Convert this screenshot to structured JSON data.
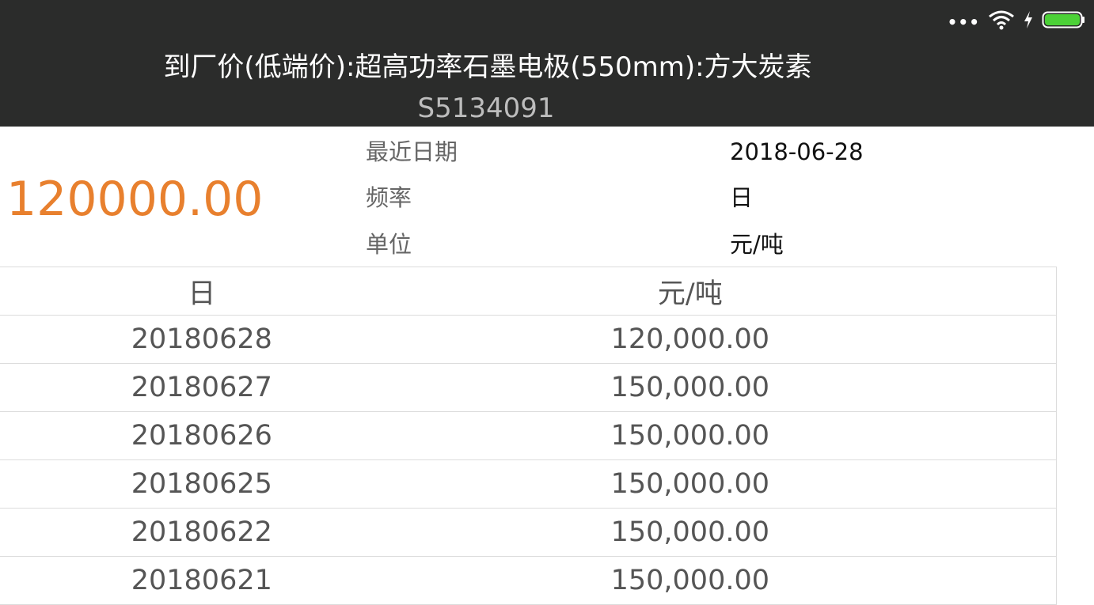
{
  "header": {
    "title": "到厂价(低端价):超高功率石墨电极(550mm):方大炭素",
    "code": "S5134091",
    "bg_color": "#2b2c2b",
    "status_icons": [
      "more-dots-icon",
      "wifi-icon",
      "charging-bolt-icon",
      "battery-icon"
    ],
    "status_dots": "•••"
  },
  "summary": {
    "latest_value": "120000.00",
    "value_color": "#e8802e",
    "rows": [
      {
        "label": "最近日期",
        "value": "2018-06-28"
      },
      {
        "label": "频率",
        "value": "日"
      },
      {
        "label": "单位",
        "value": "元/吨"
      }
    ]
  },
  "table": {
    "headers": [
      "日",
      "元/吨"
    ],
    "rows": [
      [
        "20180628",
        "120,000.00"
      ],
      [
        "20180627",
        "150,000.00"
      ],
      [
        "20180626",
        "150,000.00"
      ],
      [
        "20180625",
        "150,000.00"
      ],
      [
        "20180622",
        "150,000.00"
      ],
      [
        "20180621",
        "150,000.00"
      ]
    ]
  }
}
